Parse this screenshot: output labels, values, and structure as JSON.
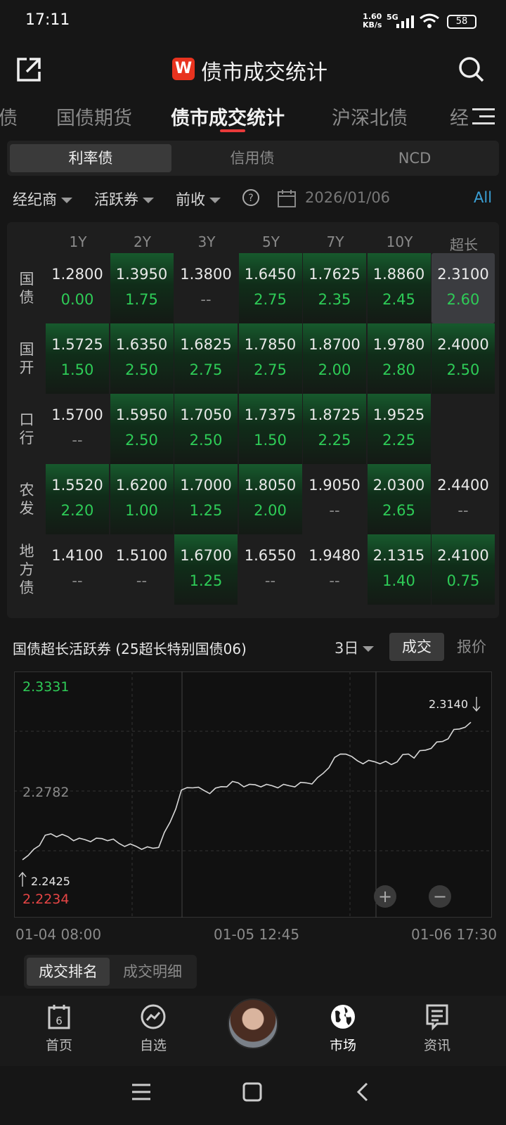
{
  "status": {
    "time": "17:11",
    "net_speed": "1.60",
    "net_unit": "KB/s",
    "net_type": "5G",
    "battery": "58"
  },
  "header": {
    "logo": "W",
    "title": "债市成交统计"
  },
  "tabs": [
    {
      "label": "债"
    },
    {
      "label": "国债期货"
    },
    {
      "label": "债市成交统计",
      "active": true
    },
    {
      "label": "沪深北债"
    },
    {
      "label": "经"
    }
  ],
  "segments": [
    {
      "label": "利率债",
      "active": true
    },
    {
      "label": "信用债"
    },
    {
      "label": "NCD"
    }
  ],
  "filters": {
    "broker": "经纪商",
    "active_bond": "活跃券",
    "prev_close": "前收",
    "date": "2026/01/06",
    "all": "All"
  },
  "grid": {
    "columns": [
      "1Y",
      "2Y",
      "3Y",
      "5Y",
      "7Y",
      "10Y",
      "超长"
    ],
    "rows": [
      {
        "name": "国\n债",
        "cells": [
          {
            "v": "1.2800",
            "c": "0.00",
            "green": false
          },
          {
            "v": "1.3950",
            "c": "1.75",
            "green": true
          },
          {
            "v": "1.3800",
            "c": "--",
            "green": false
          },
          {
            "v": "1.6450",
            "c": "2.75",
            "green": true
          },
          {
            "v": "1.7625",
            "c": "2.35",
            "green": true
          },
          {
            "v": "1.8860",
            "c": "2.45",
            "green": true
          },
          {
            "v": "2.3100",
            "c": "2.60",
            "green": false,
            "selected": true
          }
        ]
      },
      {
        "name": "国\n开",
        "cells": [
          {
            "v": "1.5725",
            "c": "1.50",
            "green": true
          },
          {
            "v": "1.6350",
            "c": "2.50",
            "green": true
          },
          {
            "v": "1.6825",
            "c": "2.75",
            "green": true
          },
          {
            "v": "1.7850",
            "c": "2.75",
            "green": true
          },
          {
            "v": "1.8700",
            "c": "2.00",
            "green": true
          },
          {
            "v": "1.9780",
            "c": "2.80",
            "green": true
          },
          {
            "v": "2.4000",
            "c": "2.50",
            "green": true
          }
        ]
      },
      {
        "name": "口\n行",
        "cells": [
          {
            "v": "1.5700",
            "c": "--",
            "green": false
          },
          {
            "v": "1.5950",
            "c": "2.50",
            "green": true
          },
          {
            "v": "1.7050",
            "c": "2.50",
            "green": true
          },
          {
            "v": "1.7375",
            "c": "1.50",
            "green": true
          },
          {
            "v": "1.8725",
            "c": "2.25",
            "green": true
          },
          {
            "v": "1.9525",
            "c": "2.25",
            "green": true
          },
          {
            "v": "",
            "c": "",
            "green": false
          }
        ]
      },
      {
        "name": "农\n发",
        "cells": [
          {
            "v": "1.5520",
            "c": "2.20",
            "green": true
          },
          {
            "v": "1.6200",
            "c": "1.00",
            "green": true
          },
          {
            "v": "1.7000",
            "c": "1.25",
            "green": true
          },
          {
            "v": "1.8050",
            "c": "2.00",
            "green": true
          },
          {
            "v": "1.9050",
            "c": "--",
            "green": false
          },
          {
            "v": "2.0300",
            "c": "2.65",
            "green": true
          },
          {
            "v": "2.4400",
            "c": "--",
            "green": false
          }
        ]
      },
      {
        "name": "地\n方\n债",
        "cells": [
          {
            "v": "1.4100",
            "c": "--",
            "green": false
          },
          {
            "v": "1.5100",
            "c": "--",
            "green": false
          },
          {
            "v": "1.6700",
            "c": "1.25",
            "green": true
          },
          {
            "v": "1.6550",
            "c": "--",
            "green": false
          },
          {
            "v": "1.9480",
            "c": "--",
            "green": false
          },
          {
            "v": "2.1315",
            "c": "1.40",
            "green": true
          },
          {
            "v": "2.4100",
            "c": "0.75",
            "green": true
          }
        ]
      }
    ]
  },
  "chart_section": {
    "title": "国债超长活跃券 (25超长特别国债06)",
    "period": "3日",
    "deal_label": "成交",
    "quote_label": "报价"
  },
  "chart_data": {
    "type": "line",
    "y_max_label": "2.3331",
    "y_mid_label": "2.2782",
    "y_min_label": "2.2234",
    "ylim": [
      2.2234,
      2.3331
    ],
    "x_ticks": [
      "01-04 08:00",
      "01-05 12:45",
      "01-06 17:30"
    ],
    "start_label": "2.2425",
    "end_label": "2.3140",
    "series": [
      {
        "values": [
          2.2425,
          2.244,
          2.248,
          2.251,
          2.2545,
          2.256,
          2.2555,
          2.255,
          2.2545,
          2.2535,
          2.253,
          2.253,
          2.253,
          2.253,
          2.2535,
          2.2535,
          2.2525,
          2.251,
          2.2505,
          2.25,
          2.2495,
          2.249,
          2.2485,
          2.2485,
          2.25,
          2.256,
          2.262,
          2.27,
          2.278,
          2.28,
          2.281,
          2.2795,
          2.2785,
          2.278,
          2.279,
          2.2805,
          2.2815,
          2.2825,
          2.2825,
          2.2815,
          2.281,
          2.2815,
          2.2815,
          2.281,
          2.281,
          2.281,
          2.281,
          2.281,
          2.2815,
          2.282,
          2.2825,
          2.283,
          2.2845,
          2.2875,
          2.2915,
          2.295,
          2.2975,
          2.2985,
          2.2955,
          2.294,
          2.2935,
          2.2935,
          2.2935,
          2.2935,
          2.293,
          2.292,
          2.2945,
          2.2965,
          2.2975,
          2.2965,
          2.2985,
          2.2995,
          2.3015,
          2.303,
          2.304,
          2.3065,
          2.3095,
          2.3105,
          2.3125,
          2.314
        ]
      }
    ],
    "annotations": [
      "+",
      "−"
    ]
  },
  "subtabs": [
    {
      "label": "成交排名",
      "active": true
    },
    {
      "label": "成交明细"
    }
  ],
  "nav": [
    {
      "label": "首页",
      "icon": "calendar-icon",
      "badge": "6"
    },
    {
      "label": "自选",
      "icon": "trend-icon"
    },
    {
      "label": "",
      "icon": "avatar"
    },
    {
      "label": "市场",
      "icon": "globe-icon",
      "active": true
    },
    {
      "label": "资讯",
      "icon": "news-icon"
    }
  ]
}
